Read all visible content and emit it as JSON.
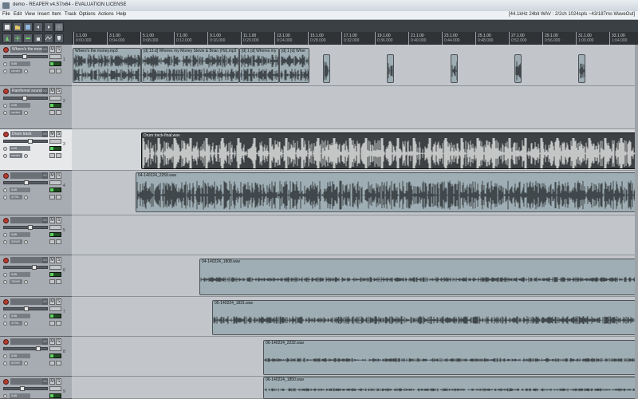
{
  "window": {
    "title": "demo - REAPER v4.57/x64 - EVALUATION LICENSE"
  },
  "menu": {
    "items": [
      "File",
      "Edit",
      "View",
      "Insert",
      "Item",
      "Track",
      "Options",
      "Actions",
      "Help"
    ],
    "status": "[44.1kHz 24bit WAV : 2/2ch 1024spls ~43/187ms WaveOut]"
  },
  "toolbar": {
    "icons": [
      "new-project-icon",
      "open-project-icon",
      "save-project-icon",
      "undo-icon",
      "redo-icon",
      "grid-icon",
      "metronome-icon",
      "snap-icon",
      "ripple-icon",
      "lock-icon",
      "envelope-icon",
      "marker-icon"
    ]
  },
  "ruler": {
    "ticks": [
      {
        "bar": "1.1.00",
        "time": "0:00.000"
      },
      {
        "bar": "3.1.00",
        "time": "0:04.000"
      },
      {
        "bar": "5.1.00",
        "time": "0:08.000"
      },
      {
        "bar": "7.1.00",
        "time": "0:12.000"
      },
      {
        "bar": "9.1.00",
        "time": "0:16.000"
      },
      {
        "bar": "11.1.00",
        "time": "0:20.000"
      },
      {
        "bar": "13.1.00",
        "time": "0:24.000"
      },
      {
        "bar": "15.1.00",
        "time": "0:28.000"
      },
      {
        "bar": "17.1.00",
        "time": "0:32.000"
      },
      {
        "bar": "19.1.00",
        "time": "0:36.000"
      },
      {
        "bar": "21.1.00",
        "time": "0:40.000"
      },
      {
        "bar": "23.1.00",
        "time": "0:44.000"
      },
      {
        "bar": "25.1.00",
        "time": "0:48.000"
      },
      {
        "bar": "27.1.00",
        "time": "0:52.000"
      },
      {
        "bar": "29.1.00",
        "time": "0:56.000"
      },
      {
        "bar": "31.1.00",
        "time": "1:00.000"
      },
      {
        "bar": "33.1.00",
        "time": "1:04.000"
      }
    ]
  },
  "tracks": [
    {
      "name": "Where's the money",
      "number": "1",
      "volume": 0.45,
      "label": "0dB",
      "pan": "center",
      "selected": false
    },
    {
      "name": "Rainforest sounds",
      "number": "2",
      "volume": 0.45,
      "label": "0dB",
      "pan": "center",
      "selected": false
    },
    {
      "name": "Drum track",
      "number": "3",
      "volume": 0.6,
      "label": "0dB",
      "pan": "center",
      "selected": true
    },
    {
      "name": "",
      "number": "4",
      "volume": 0.5,
      "label": "0dB",
      "pan": "47%L",
      "selected": false
    },
    {
      "name": "",
      "number": "5",
      "volume": 0.6,
      "label": "0dB",
      "pan": "28%R",
      "selected": false
    },
    {
      "name": "",
      "number": "6",
      "volume": 0.7,
      "label": "0dB",
      "pan": "78%R",
      "selected": false
    },
    {
      "name": "",
      "number": "7",
      "volume": 0.5,
      "label": "0dB",
      "pan": "47%L",
      "selected": false
    },
    {
      "name": "",
      "number": "8",
      "volume": 0.8,
      "label": "0dB",
      "pan": "60%R",
      "selected": false
    },
    {
      "name": "",
      "number": "9",
      "volume": 0.4,
      "label": "0dB",
      "pan": "center",
      "selected": false
    }
  ],
  "items": {
    "t1a": "Where's the money.mp3",
    "t1b": "[d] 13.d] Wheres my Money Stevie & Brian (Hd).mp3",
    "t1c": "[d] 1 [d] Wheres my",
    "t1d": "[d] 1 [d] Wher",
    "t3": "Drum track-final.wav",
    "t4": "04-140224_2259.wav",
    "t6": "04-140224_1808.wav",
    "t7": "05-140224_1831.wav",
    "t8": "06-140224_2232.wav",
    "t9": "06-140224_1850.wav"
  }
}
